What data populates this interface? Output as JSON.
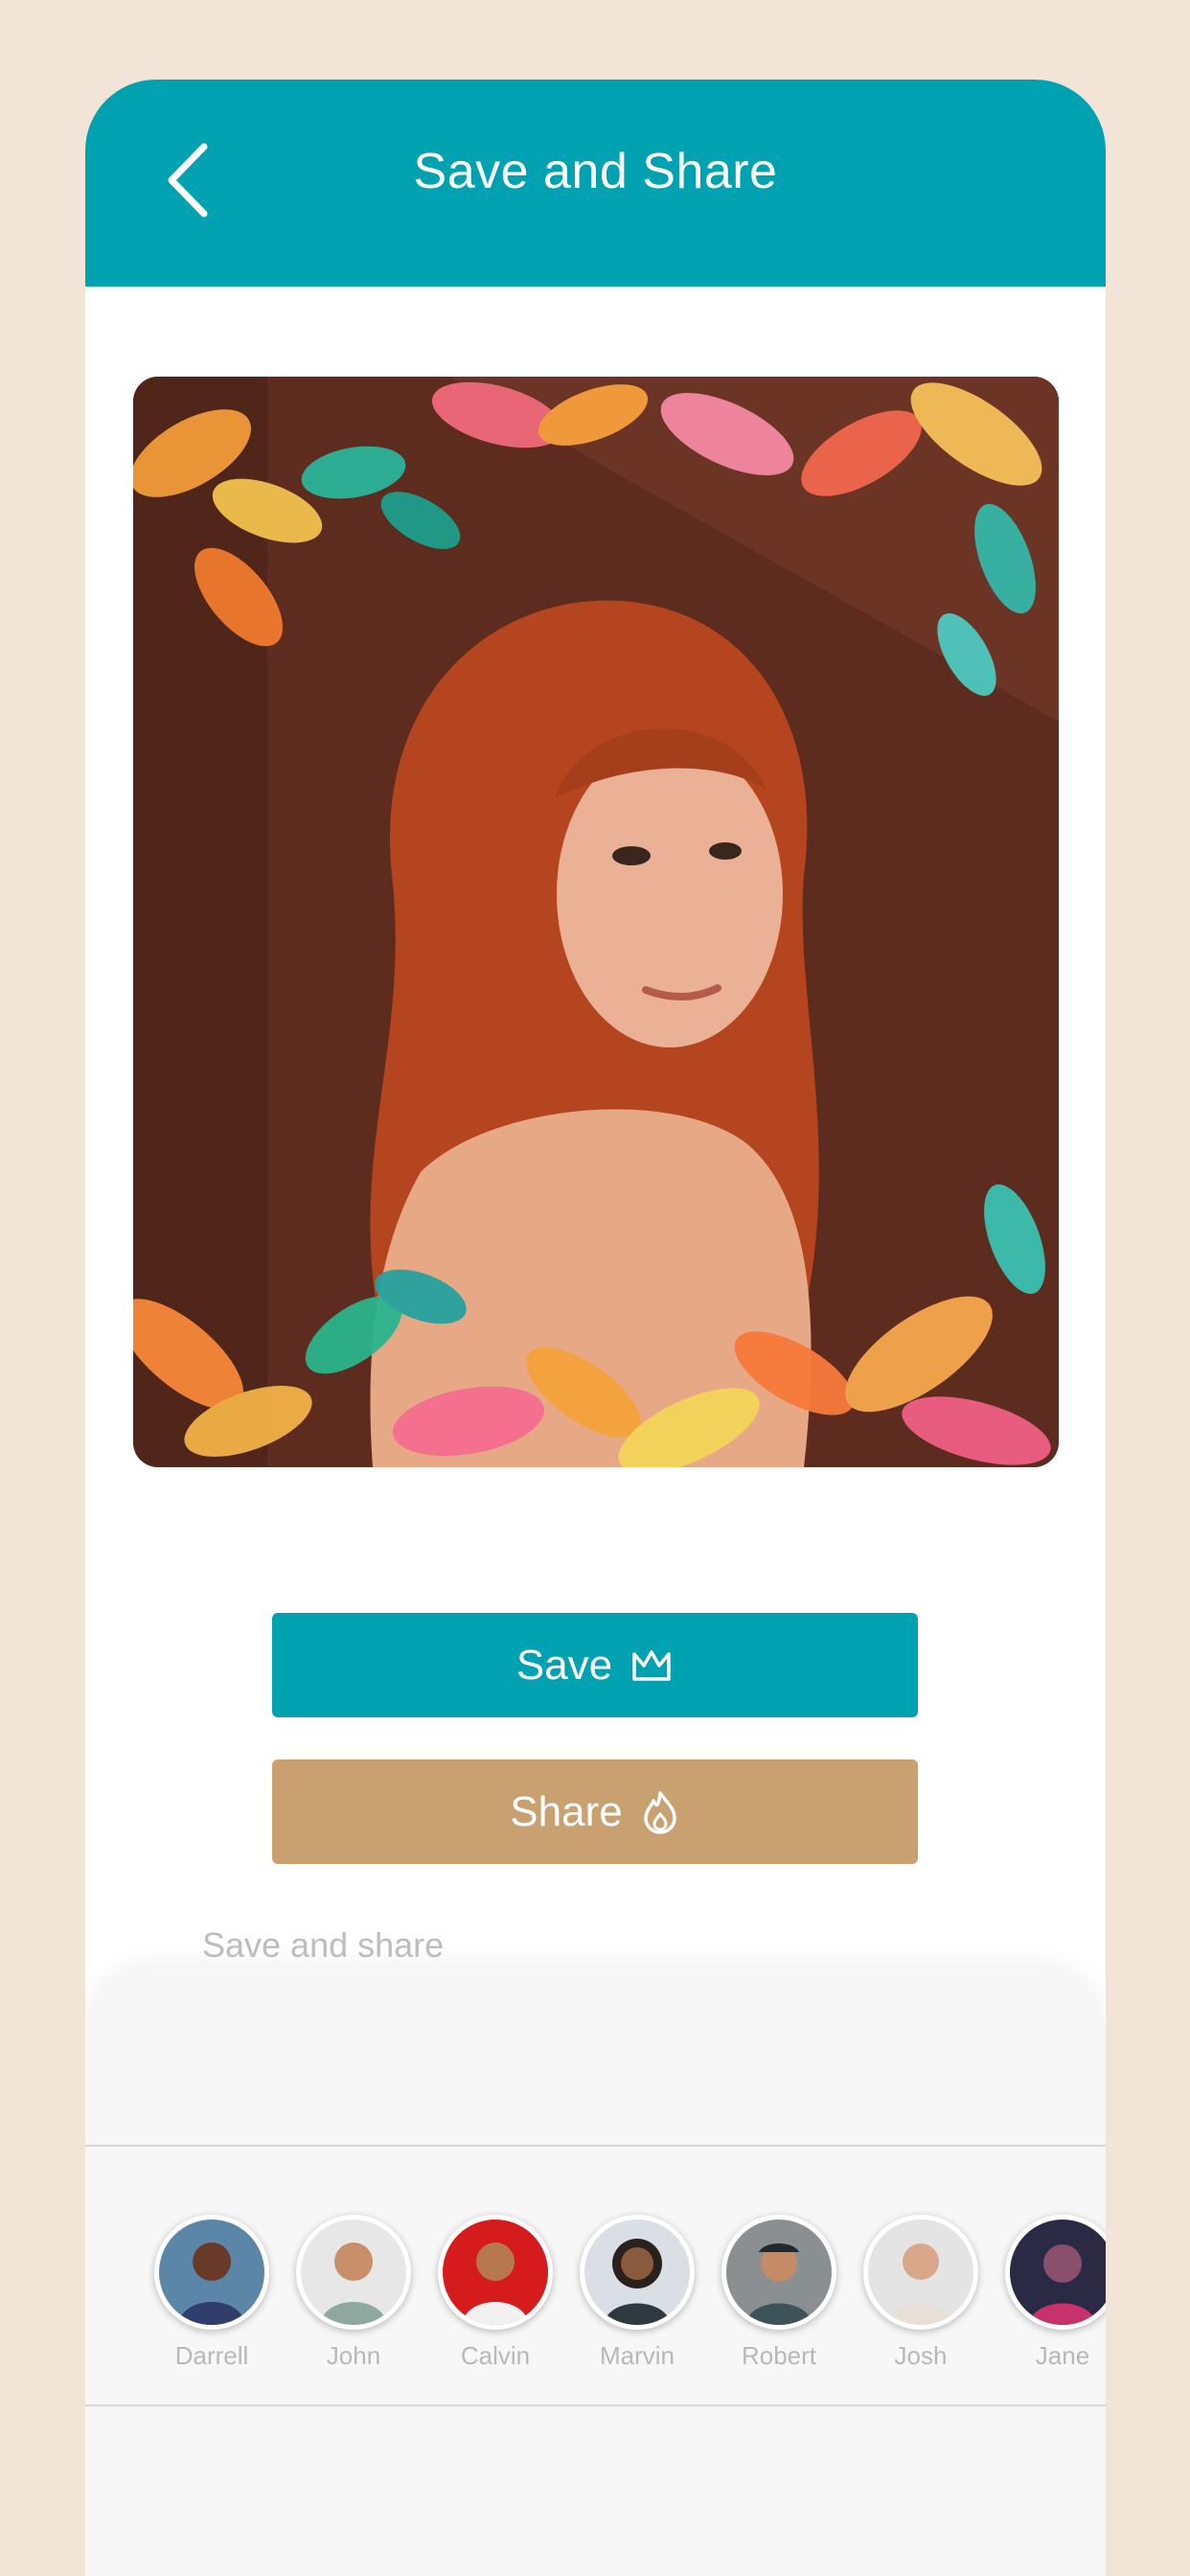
{
  "header": {
    "title": "Save and Share"
  },
  "actions": {
    "save_label": "Save",
    "share_label": "Share"
  },
  "sheet": {
    "title": "Save and share",
    "contacts": [
      {
        "name": "Darrell",
        "bg": "#5b86a8"
      },
      {
        "name": "John",
        "bg": "#e7e7e7"
      },
      {
        "name": "Calvin",
        "bg": "#d51b1b"
      },
      {
        "name": "Marvin",
        "bg": "#d9dfe4"
      },
      {
        "name": "Robert",
        "bg": "#8a8f92"
      },
      {
        "name": "Josh",
        "bg": "#e4e4e4"
      },
      {
        "name": "Jane",
        "bg": "#2a2a45"
      }
    ]
  },
  "colors": {
    "accent": "#00a1b1",
    "share": "#c9a070",
    "page_bg": "#f2e4d6"
  }
}
